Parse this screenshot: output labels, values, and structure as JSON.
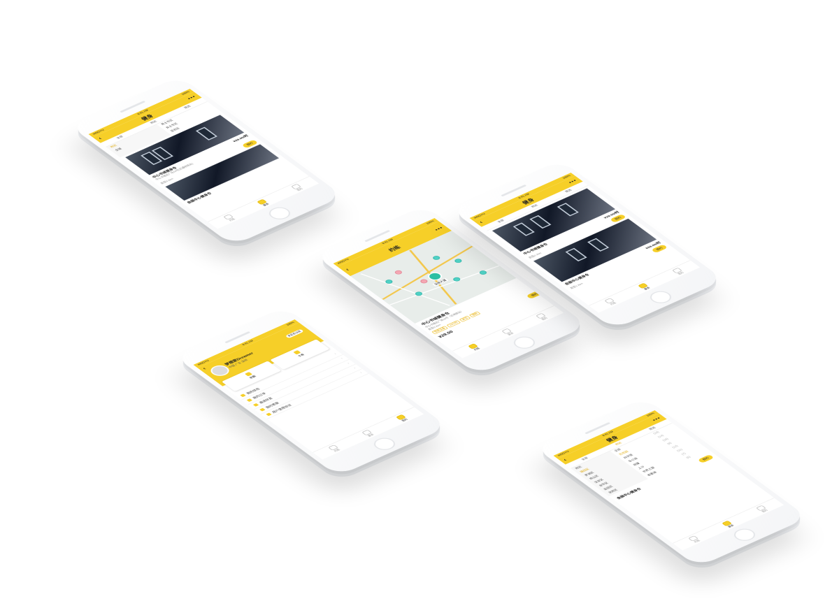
{
  "status": {
    "carrier": "XINGYU",
    "time": "9:41 AM",
    "battery": "100%"
  },
  "list_screen": {
    "title": "健身",
    "filters": [
      "全部",
      "附近",
      "筛选"
    ],
    "dropdown": {
      "col1": [
        "附近",
        "全城"
      ],
      "col2": [
        "全部",
        "(2014)"
      ],
      "col3": [
        "男士专区",
        "(410)",
        "女士专区",
        "(1210)",
        "混合区"
      ]
    },
    "cards": [
      {
        "name": "中心书城健身仓",
        "sub": "中心书城北广场16号(近通地铁站)",
        "dist": "距您0.2km",
        "price": "¥29.00/时",
        "book": "预约"
      },
      {
        "name": "会展中心健身仓",
        "sub": "福田区会展中心附近",
        "dist": "距您1.2km",
        "price": "¥29.00/时",
        "book": "预约"
      }
    ]
  },
  "map_screen": {
    "title": "约练",
    "gym": "中心书城健身仓",
    "addr": "中心书城北广场16号（近地铁站）",
    "dist": "距您0.2km",
    "tags": [
      "智能设备",
      "24小时",
      "淋浴",
      "储物"
    ],
    "price": "¥29.00",
    "book": "预约",
    "location_label": "深南大道"
  },
  "profile_screen": {
    "name": "梦想家Dreamer",
    "loc": "中国 广东 深圳",
    "badge": "未实名认证",
    "quick": [
      "余额",
      "卡券"
    ],
    "menu": [
      "我的钱包",
      "我的订单",
      "邀请好友",
      "我的客服",
      "用户使用协议"
    ]
  },
  "district_screen": {
    "title": "健身",
    "filters": [
      "全部",
      "附近",
      "筛选"
    ],
    "col1": [
      "附近",
      "福田区",
      "罗湖区",
      "南山区",
      "宝安区",
      "龙华区",
      "盐田区",
      "龙岗区"
    ],
    "col2": [
      "全部",
      "百花园",
      "科学馆",
      "车公庙",
      "岗厦",
      "上沙",
      "世界之窗",
      "香蜜湖"
    ],
    "col3": [
      "(18)",
      "(14)",
      "(16)",
      "(8)",
      "(12)",
      "(11)",
      "(7)",
      "(5)"
    ]
  },
  "tabs": [
    "约练",
    "健身",
    "我的"
  ]
}
